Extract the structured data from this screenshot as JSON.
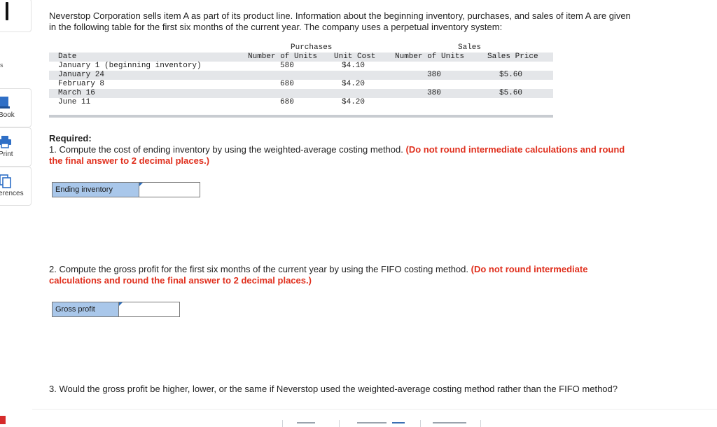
{
  "sidebar": {
    "items": [
      {
        "label": "Book",
        "icon": "book-icon"
      },
      {
        "label": "Print",
        "icon": "printer-icon"
      },
      {
        "label": "erences",
        "icon": "references-icon"
      }
    ],
    "small_char": "s"
  },
  "intro": "Neverstop Corporation sells item A as part of its product line. Information about the beginning inventory, purchases, and sales of item A are given in the following table for the first six months of the current year. The company uses a perpetual inventory system:",
  "table": {
    "group_purchases": "Purchases",
    "group_sales": "Sales",
    "col_date": "Date",
    "col_p_units": "Number of Units",
    "col_p_cost": "Unit Cost",
    "col_s_units": "Number of Units",
    "col_s_price": "Sales Price",
    "rows": [
      {
        "date": "January 1 (beginning inventory)",
        "p_units": "580",
        "p_cost": "$4.10",
        "s_units": "",
        "s_price": ""
      },
      {
        "date": "January 24",
        "p_units": "",
        "p_cost": "",
        "s_units": "380",
        "s_price": "$5.60"
      },
      {
        "date": "February 8",
        "p_units": "680",
        "p_cost": "$4.20",
        "s_units": "",
        "s_price": ""
      },
      {
        "date": "March 16",
        "p_units": "",
        "p_cost": "",
        "s_units": "380",
        "s_price": "$5.60"
      },
      {
        "date": "June 11",
        "p_units": "680",
        "p_cost": "$4.20",
        "s_units": "",
        "s_price": ""
      }
    ]
  },
  "required_label": "Required:",
  "q1": {
    "text": "1. Compute the cost of ending inventory by using the weighted-average costing method. ",
    "note": "(Do not round intermediate calculations and round the final answer to 2 decimal places.)",
    "answer_label": "Ending inventory",
    "answer_value": ""
  },
  "q2": {
    "text": "2. Compute the gross profit for the first six months of the current year by using the FIFO costing method. ",
    "note": "(Do not round intermediate calculations and round the final answer to 2 decimal places.)",
    "answer_label": "Gross profit",
    "answer_value": ""
  },
  "q3": {
    "text": "3. Would the gross profit be higher, lower, or the same if Neverstop used the weighted-average costing method rather than the FIFO method?"
  },
  "colors": {
    "accent_red": "#e0301e",
    "label_blue": "#a9c7ea",
    "table_shade": "#e4e6e9"
  }
}
